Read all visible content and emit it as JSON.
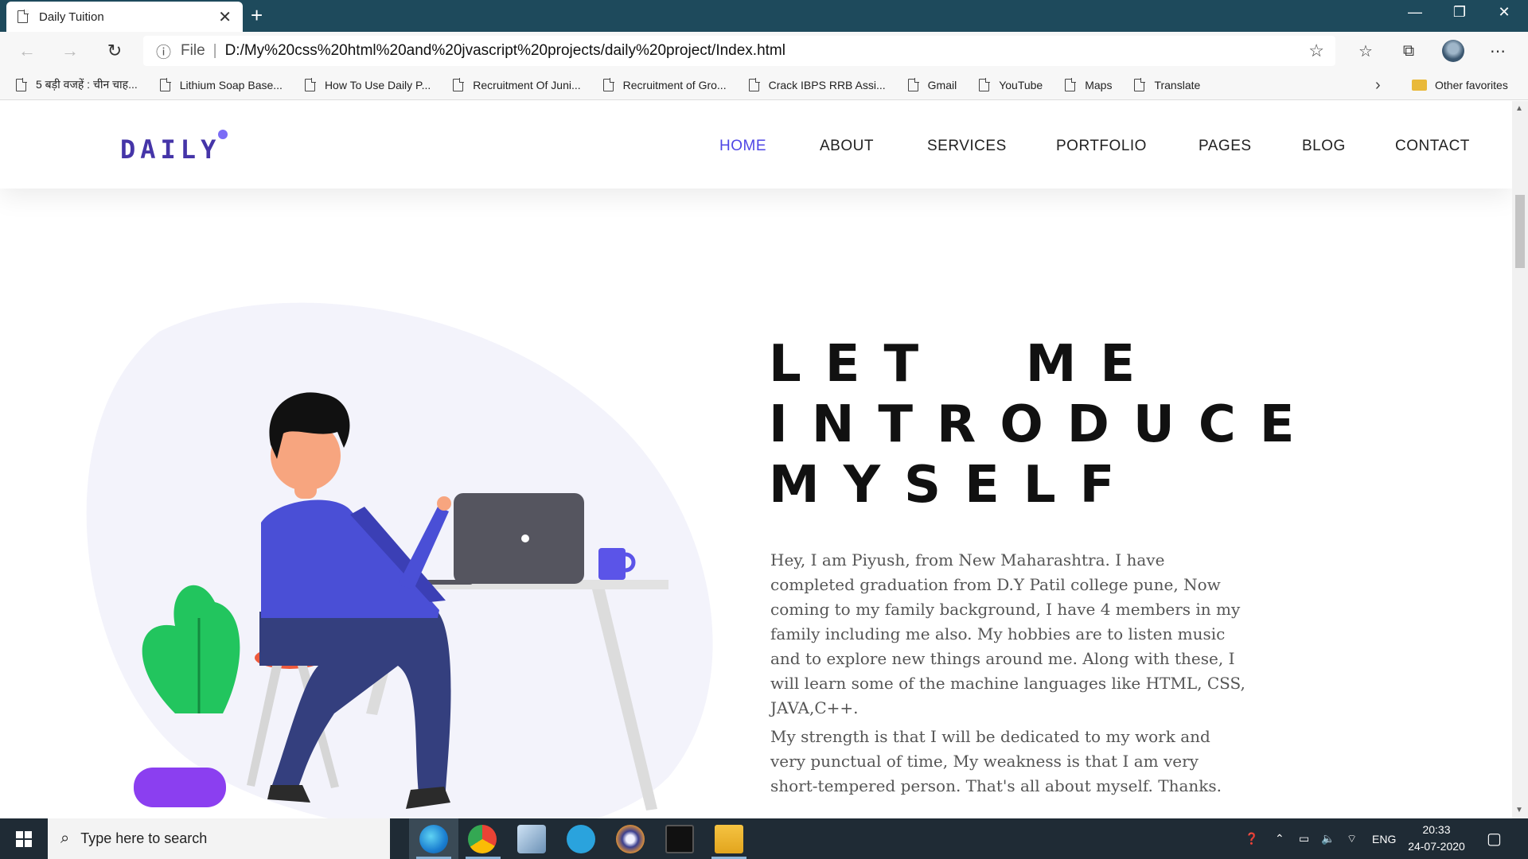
{
  "browser": {
    "tab_title": "Daily Tuition",
    "address_prefix": "File",
    "url": "D:/My%20css%20html%20and%20jvascript%20projects/daily%20project/Index.html",
    "bookmarks": [
      "5 बड़ी वजहें : चीन चाह...",
      "Lithium Soap Base...",
      "How To Use Daily P...",
      "Recruitment Of Juni...",
      "Recruitment of Gro...",
      "Crack IBPS RRB Assi...",
      "Gmail",
      "YouTube",
      "Maps",
      "Translate"
    ],
    "other_favorites": "Other favorites"
  },
  "site": {
    "logo": "DAILY",
    "nav": [
      "HOME",
      "ABOUT",
      "SERVICES",
      "PORTFOLIO",
      "PAGES",
      "BLOG",
      "CONTACT"
    ],
    "active_nav": "HOME",
    "heading_lines": [
      "LET  ME",
      "INTRODUCE",
      "MYSELF"
    ],
    "paragraph_1": "Hey, I am Piyush, from New Maharashtra. I have completed graduation from D.Y Patil college pune, Now coming to my family background, I have 4 members in my family including me also. My hobbies are to listen music and to explore new things around me. Along with these, I will learn some of the machine languages like HTML, CSS, JAVA,C++.",
    "paragraph_2": "My strength is that I will be dedicated to my work and very punctual of time, My weakness is that I am very short-tempered person. That's all about myself. Thanks."
  },
  "taskbar": {
    "search_placeholder": "Type here to search",
    "language": "ENG",
    "time": "20:33",
    "date": "24-07-2020"
  },
  "colors": {
    "titlebar": "#1e4a5c",
    "accent": "#4f46e5",
    "logo": "#4535a8"
  }
}
